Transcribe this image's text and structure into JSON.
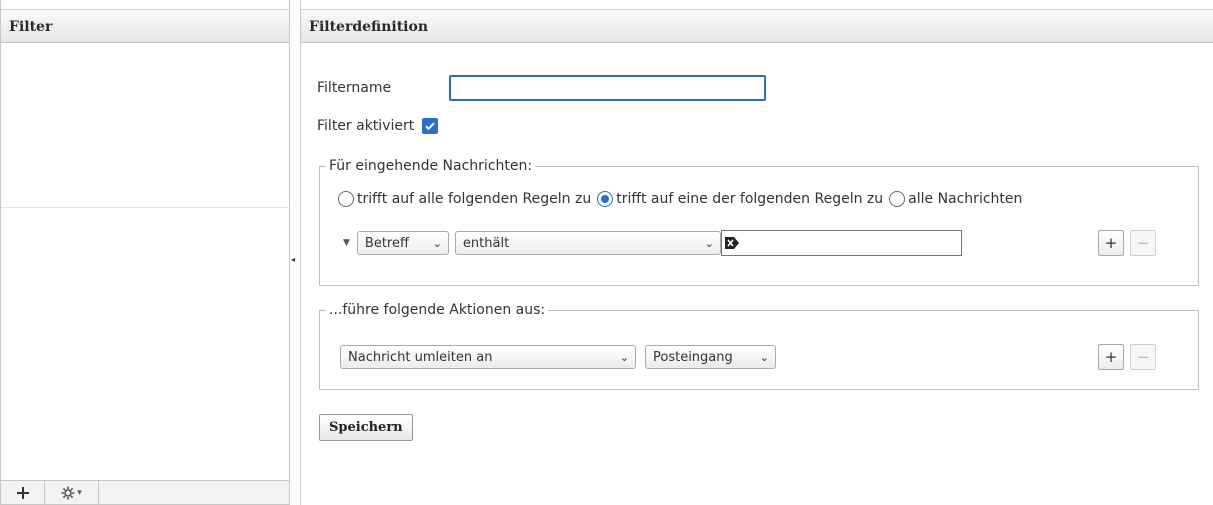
{
  "left_panel": {
    "title": "Filter",
    "footer": {
      "add_icon": "plus-icon",
      "settings_icon": "gear-icon",
      "settings_caret": "▾"
    }
  },
  "right_panel": {
    "title": "Filterdefinition",
    "filter_name": {
      "label": "Filtername",
      "value": ""
    },
    "filter_active": {
      "label": "Filter aktiviert",
      "checked": true
    },
    "incoming": {
      "legend": "Für eingehende Nachrichten:",
      "match_options": [
        {
          "label": "trifft auf alle folgenden Regeln zu",
          "checked": false
        },
        {
          "label": "trifft auf eine der folgenden Regeln zu",
          "checked": true
        },
        {
          "label": "alle Nachrichten",
          "checked": false
        }
      ],
      "rule": {
        "field": "Betreff",
        "operator": "enthält",
        "value": "",
        "add": "+",
        "remove": "−"
      }
    },
    "actions": {
      "legend": "...führe folgende Aktionen aus:",
      "action": "Nachricht umleiten an",
      "target": "Posteingang",
      "add": "+",
      "remove": "−"
    },
    "save_label": "Speichern"
  },
  "colors": {
    "accent": "#2a6fc9",
    "header_bg": "#e6e6e6",
    "border": "#c8c8c8"
  }
}
